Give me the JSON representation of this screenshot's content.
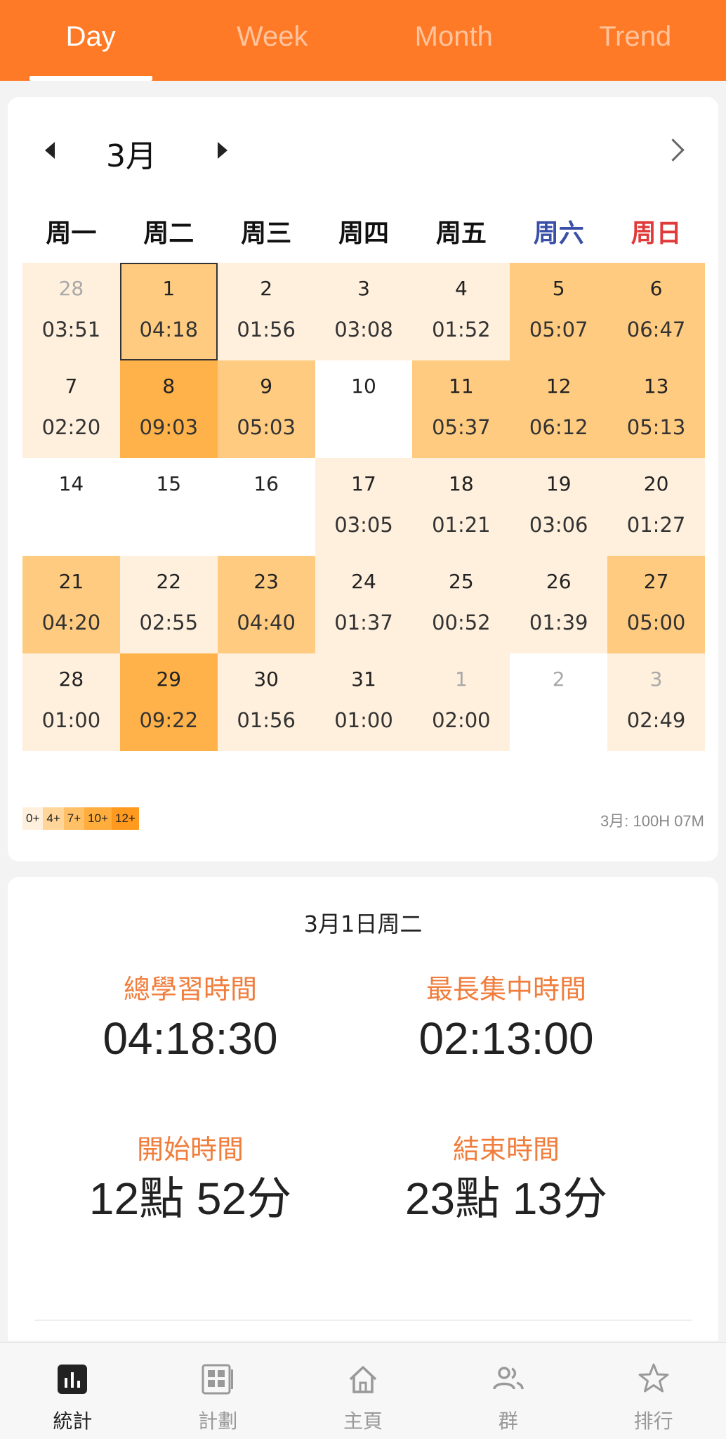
{
  "tabs": [
    "Day",
    "Week",
    "Month",
    "Trend"
  ],
  "calendar": {
    "month_label": "3月",
    "weekdays": [
      "周一",
      "周二",
      "周三",
      "周四",
      "周五",
      "周六",
      "周日"
    ],
    "cells": [
      {
        "day": "28",
        "time": "03:51",
        "level": 1,
        "other_month": true
      },
      {
        "day": "1",
        "time": "04:18",
        "level": 2,
        "selected": true
      },
      {
        "day": "2",
        "time": "01:56",
        "level": 1
      },
      {
        "day": "3",
        "time": "03:08",
        "level": 1
      },
      {
        "day": "4",
        "time": "01:52",
        "level": 1
      },
      {
        "day": "5",
        "time": "05:07",
        "level": 2
      },
      {
        "day": "6",
        "time": "06:47",
        "level": 2
      },
      {
        "day": "7",
        "time": "02:20",
        "level": 1
      },
      {
        "day": "8",
        "time": "09:03",
        "level": 3
      },
      {
        "day": "9",
        "time": "05:03",
        "level": 2
      },
      {
        "day": "10",
        "time": "",
        "level": 0
      },
      {
        "day": "11",
        "time": "05:37",
        "level": 2
      },
      {
        "day": "12",
        "time": "06:12",
        "level": 2
      },
      {
        "day": "13",
        "time": "05:13",
        "level": 2
      },
      {
        "day": "14",
        "time": "",
        "level": 0
      },
      {
        "day": "15",
        "time": "",
        "level": 0
      },
      {
        "day": "16",
        "time": "",
        "level": 0
      },
      {
        "day": "17",
        "time": "03:05",
        "level": 1
      },
      {
        "day": "18",
        "time": "01:21",
        "level": 1
      },
      {
        "day": "19",
        "time": "03:06",
        "level": 1
      },
      {
        "day": "20",
        "time": "01:27",
        "level": 1
      },
      {
        "day": "21",
        "time": "04:20",
        "level": 2
      },
      {
        "day": "22",
        "time": "02:55",
        "level": 1
      },
      {
        "day": "23",
        "time": "04:40",
        "level": 2
      },
      {
        "day": "24",
        "time": "01:37",
        "level": 1
      },
      {
        "day": "25",
        "time": "00:52",
        "level": 1
      },
      {
        "day": "26",
        "time": "01:39",
        "level": 1
      },
      {
        "day": "27",
        "time": "05:00",
        "level": 2
      },
      {
        "day": "28",
        "time": "01:00",
        "level": 1
      },
      {
        "day": "29",
        "time": "09:22",
        "level": 3
      },
      {
        "day": "30",
        "time": "01:56",
        "level": 1
      },
      {
        "day": "31",
        "time": "01:00",
        "level": 1
      },
      {
        "day": "1",
        "time": "02:00",
        "level": 1,
        "other_month": true
      },
      {
        "day": "2",
        "time": "",
        "level": 0,
        "other_month": true
      },
      {
        "day": "3",
        "time": "02:49",
        "level": 1,
        "other_month": true
      }
    ],
    "legend": [
      "0+",
      "4+",
      "7+",
      "10+",
      "12+"
    ],
    "month_total": "3月: 100H 07M"
  },
  "detail": {
    "date": "3月1日周二",
    "total_label": "總學習時間",
    "total_value": "04:18:30",
    "longest_label": "最長集中時間",
    "longest_value": "02:13:00",
    "start_label": "開始時間",
    "start_value": "12點 52分",
    "end_label": "結束時間",
    "end_value": "23點 13分"
  },
  "nav": [
    {
      "label": "統計",
      "icon": "bar-chart-icon",
      "active": true
    },
    {
      "label": "計劃",
      "icon": "planner-icon"
    },
    {
      "label": "主頁",
      "icon": "home-icon"
    },
    {
      "label": "群",
      "icon": "group-icon"
    },
    {
      "label": "排行",
      "icon": "star-icon"
    }
  ],
  "colors": {
    "accent": "#ff7a26",
    "label_orange": "#f07d3c",
    "saturday": "#3a4fa8",
    "sunday": "#e03a3a"
  }
}
